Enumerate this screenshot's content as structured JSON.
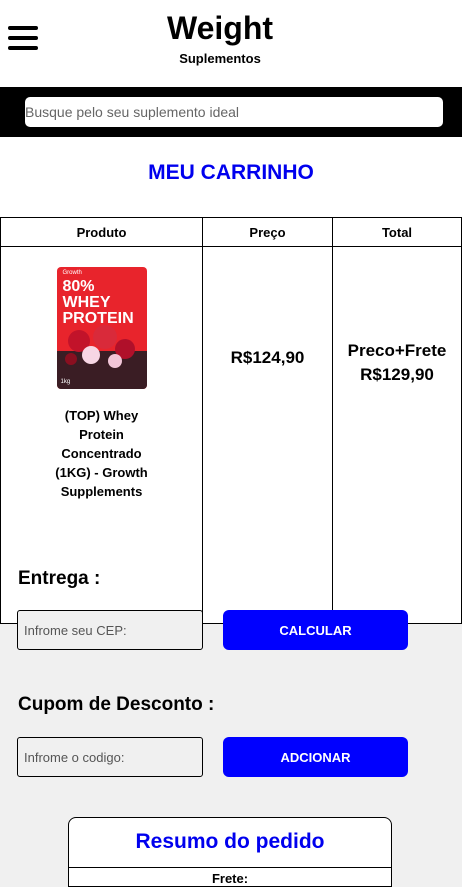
{
  "header": {
    "title": "Weight",
    "subtitle": "Suplementos",
    "menu_icon": "hamburger-menu-icon"
  },
  "search": {
    "placeholder": "Busque pelo seu suplemento ideal",
    "value": ""
  },
  "cart": {
    "title": "MEU CARRINHO",
    "columns": [
      "Produto",
      "Preço",
      "Total"
    ],
    "items": [
      {
        "image_text_top": "80% WHEY PROTEIN",
        "image_brand": "Growth",
        "image_weight": "1kg",
        "name": "(TOP) Whey Protein Concentrado (1KG) - Growth Supplements",
        "price": "R$124,90",
        "total_label": "Preco+Frete",
        "total": "R$129,90"
      }
    ]
  },
  "shipping": {
    "label": "Entrega :",
    "placeholder": "Infrome seu CEP:",
    "value": "",
    "button": "CALCULAR"
  },
  "coupon": {
    "label": "Cupom de Desconto :",
    "placeholder": "Infrome o codigo:",
    "value": "",
    "button": "ADCIONAR"
  },
  "summary": {
    "title": "Resumo do pedido",
    "frete_label": "Frete:"
  },
  "colors": {
    "accent": "#0000ff",
    "title_blue": "#0000ee",
    "search_bar": "#000000",
    "background": "#f0f0f0"
  }
}
